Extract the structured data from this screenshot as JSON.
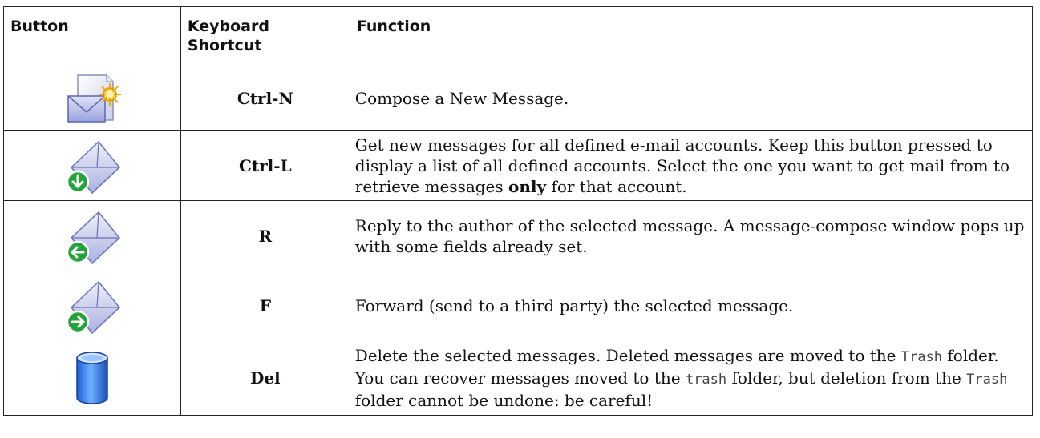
{
  "header": {
    "button": "Button",
    "shortcut": "Keyboard Shortcut",
    "function": "Function"
  },
  "rows": [
    {
      "icon": "compose-message-icon",
      "shortcut": "Ctrl-N",
      "function": [
        {
          "t": "Compose a New Message."
        }
      ]
    },
    {
      "icon": "get-mail-icon",
      "shortcut": "Ctrl-L",
      "function": [
        {
          "t": "Get new messages for all defined e-mail accounts. Keep this button pressed to display a list of all defined accounts. Select the one you want to get mail from to retrieve messages "
        },
        {
          "t": "only",
          "s": "bold"
        },
        {
          "t": " for that account."
        }
      ]
    },
    {
      "icon": "reply-icon",
      "shortcut": "R",
      "function": [
        {
          "t": "Reply to the author of the selected message. A message-compose window pops up with some fields already set."
        }
      ]
    },
    {
      "icon": "forward-icon",
      "shortcut": "F",
      "function": [
        {
          "t": "Forward (send to a third party) the selected message."
        }
      ]
    },
    {
      "icon": "trash-icon",
      "shortcut": "Del",
      "function": [
        {
          "t": "Delete the selected messages. Deleted messages are moved to the "
        },
        {
          "t": "Trash",
          "s": "mono"
        },
        {
          "t": " folder. You can recover messages moved to the "
        },
        {
          "t": "trash",
          "s": "mono"
        },
        {
          "t": " folder, but deletion from the "
        },
        {
          "t": "Trash",
          "s": "mono"
        },
        {
          "t": " folder cannot be undone: be careful!"
        }
      ]
    }
  ]
}
